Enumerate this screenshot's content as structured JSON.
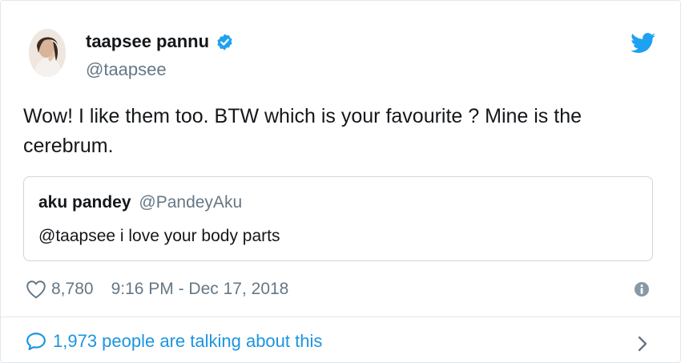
{
  "author": {
    "name": "taapsee pannu",
    "handle": "@taapsee",
    "verified": true
  },
  "tweet": {
    "text": "Wow! I like them too. BTW which is your favourite ? Mine is the cerebrum."
  },
  "quoted_tweet": {
    "name": "aku pandey",
    "handle": "@PandeyAku",
    "text": "@taapsee i love your body parts"
  },
  "meta": {
    "likes": "8,780",
    "timestamp": "9:16 PM - Dec 17, 2018"
  },
  "footer": {
    "talking": "1,973 people are talking about this"
  },
  "icons": {
    "bird": "twitter-bird-icon",
    "verified": "verified-badge-icon",
    "like": "heart-icon",
    "info": "info-icon",
    "reply": "speech-bubble-icon",
    "more": "chevron-right-icon"
  },
  "colors": {
    "twitter_blue": "#1da1f2",
    "link_blue": "#1b95e0",
    "secondary_text": "#657786",
    "border": "#e1e8ed"
  }
}
